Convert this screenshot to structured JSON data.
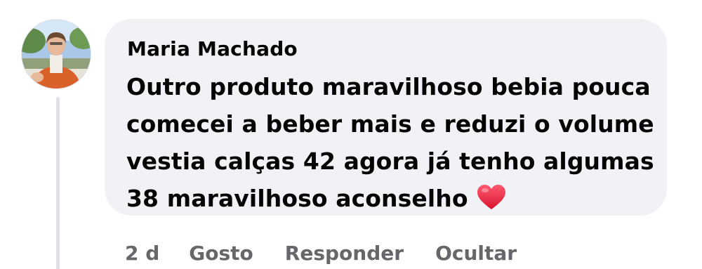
{
  "comment": {
    "author": "Maria Machado",
    "avatar_alt": "Maria Machado",
    "lines": [
      "Outro produto maravilhoso bebia pouca",
      "comecei a beber mais e reduzi o volume",
      "vestia calças 42 agora já tenho algumas",
      "38 maravilhoso aconselho"
    ],
    "emoji_icon": "red-heart-icon"
  },
  "actions": {
    "timestamp": "2 d",
    "like_label": "Gosto",
    "reply_label": "Responder",
    "hide_label": "Ocultar"
  },
  "colors": {
    "bubble_bg": "#f0f2f5",
    "text": "#050505",
    "secondary_text": "#65676b",
    "thread_line": "#dfe1e5",
    "heart": "#e0245e"
  }
}
